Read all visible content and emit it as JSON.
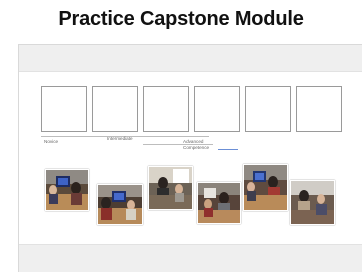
{
  "title": "Practice Capstone Module",
  "scale": {
    "novice_label": "Novice",
    "intermediate_label": "Intermediate",
    "advanced_label": "Advanced",
    "competence_label": "Competence"
  },
  "placeholder_box_count": 6,
  "photo_count": 6,
  "colors": {
    "band": "#efefef",
    "box_border": "#9a9a9a",
    "accent_line": "#6b8fd6"
  }
}
